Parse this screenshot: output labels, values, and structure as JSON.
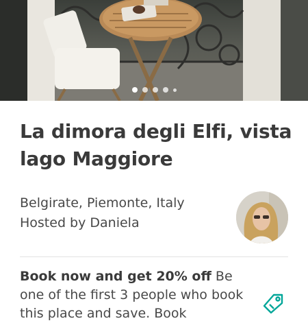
{
  "listing": {
    "title": "La dimora degli Elfi, vista lago Maggiore",
    "location": "Belgirate, Piemonte, Italy",
    "host": "Hosted by Daniela"
  },
  "carousel": {
    "photo_count": 5,
    "current_index": 0
  },
  "promo": {
    "bold": "Book now and get 20% off",
    "text": " Be one of the first 3 people who book this place and save. Book"
  },
  "colors": {
    "accent": "#00a699",
    "text": "#484848"
  },
  "icons": {
    "promo_icon": "price-tag-icon"
  }
}
